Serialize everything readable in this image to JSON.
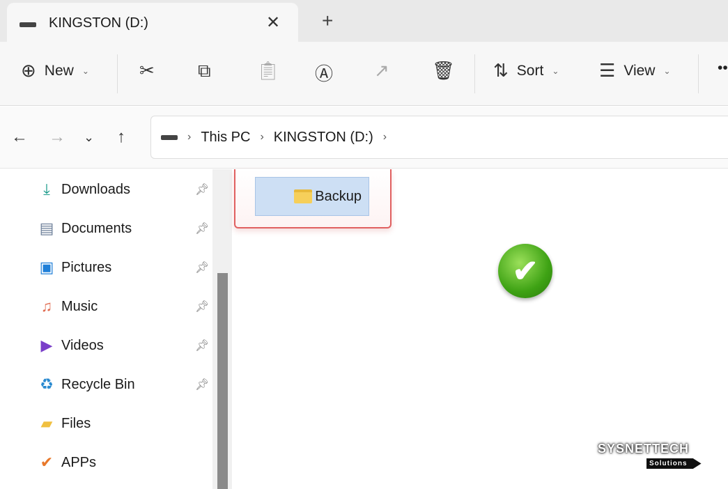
{
  "tab": {
    "title": "KINGSTON (D:)",
    "close": "✕",
    "new_tab": "+"
  },
  "toolbar": {
    "new": "New",
    "sort": "Sort",
    "view": "View",
    "more": "••"
  },
  "address": {
    "crumbs": [
      "This PC",
      "KINGSTON (D:)"
    ]
  },
  "sidebar": {
    "items": [
      {
        "label": "Downloads",
        "icon": "download-icon",
        "pinned": true
      },
      {
        "label": "Documents",
        "icon": "document-icon",
        "pinned": true
      },
      {
        "label": "Pictures",
        "icon": "picture-icon",
        "pinned": true
      },
      {
        "label": "Music",
        "icon": "music-icon",
        "pinned": true
      },
      {
        "label": "Videos",
        "icon": "video-icon",
        "pinned": true
      },
      {
        "label": "Recycle Bin",
        "icon": "recycle-bin-icon",
        "pinned": true
      },
      {
        "label": "Files",
        "icon": "folder-icon",
        "pinned": false
      },
      {
        "label": "APPs",
        "icon": "checkmark-icon",
        "pinned": false
      }
    ]
  },
  "content": {
    "folder": "Backup"
  },
  "watermark": {
    "title": "SYSNETTECH",
    "subtitle": "Solutions"
  }
}
